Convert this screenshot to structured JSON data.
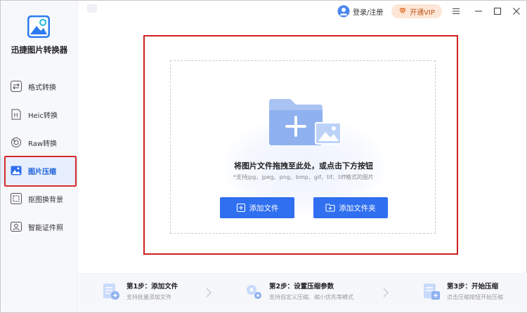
{
  "app": {
    "title": "迅捷图片转换器"
  },
  "sidebar": {
    "items": [
      {
        "label": "格式转换",
        "icon": "swap-arrows-icon",
        "active": false
      },
      {
        "label": "Heic转换",
        "icon": "heic-file-icon",
        "active": false
      },
      {
        "label": "Raw转换",
        "icon": "raw-camera-icon",
        "active": false
      },
      {
        "label": "图片压缩",
        "icon": "image-compress-icon",
        "active": true
      },
      {
        "label": "抠图换背景",
        "icon": "cutout-icon",
        "active": false
      },
      {
        "label": "智能证件照",
        "icon": "id-photo-icon",
        "active": false
      }
    ]
  },
  "titlebar": {
    "login_label": "登录/注册",
    "vip_label": "开通VIP",
    "vip_color": "#c0571f"
  },
  "main": {
    "drop_title": "将图片文件拖拽至此处，或点击下方按钮",
    "drop_hint": "*支持jpg、jpeg、png、bmp、gif、tif、tiff格式的图片",
    "add_file_label": "添加文件",
    "add_folder_label": "添加文件夹",
    "accent_color": "#2f6ff0",
    "highlight_color": "#cf2020"
  },
  "steps": [
    {
      "title": "第1步：添加文件",
      "desc": "支持批量添加文件",
      "icon": "add-file-step-icon"
    },
    {
      "title": "第2步：设置压缩参数",
      "desc": "支持自定义压缩、缩小优先等模式",
      "icon": "settings-gears-icon"
    },
    {
      "title": "第3步：开始压缩",
      "desc": "点击压缩按钮开始压缩",
      "icon": "compress-start-icon"
    }
  ]
}
